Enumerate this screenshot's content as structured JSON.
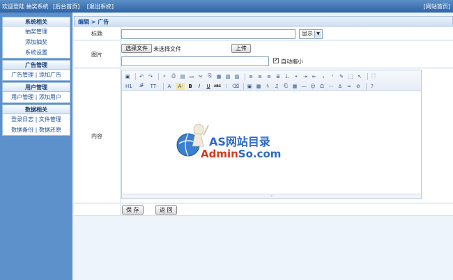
{
  "topbar": {
    "welcome": "欢迎登陆 抽奖系统",
    "nav": [
      "[后台首页]",
      "[退出系统]"
    ],
    "home": "[网站首页]"
  },
  "sidebar": {
    "groups": [
      {
        "title": "系统相关",
        "items": [
          "抽奖管理",
          "添加抽奖",
          "系统设置"
        ]
      },
      {
        "title": "广告管理",
        "items": [
          "广告管理 | 添加广告"
        ]
      },
      {
        "title": "用户管理",
        "items": [
          "用户管理 | 添加用户"
        ]
      },
      {
        "title": "数据相关",
        "items": [
          "登录日志 | 文件管理",
          "数据备份 | 数据还原"
        ]
      }
    ]
  },
  "breadcrumb": "编辑 > 广告",
  "form": {
    "title_label": "标题",
    "title_value": "",
    "display_select": "显示",
    "image_label": "图片",
    "choose_file": "选择文件",
    "no_file": "未选择文件",
    "upload": "上传",
    "image_path": "",
    "auto_shrink": "自动缩小",
    "content_label": "内容",
    "save": "保 存",
    "back": "返 回"
  },
  "toolbar": {
    "row2_labels": [
      "H1·",
      "𝓕·",
      "TT·",
      "A·",
      "A·",
      "B",
      "I",
      "U",
      "ABC"
    ]
  },
  "watermark": {
    "line1": "AS网站目录",
    "line2_a": "Admin",
    "line2_b": "So.com"
  },
  "colors": {
    "header": "#2e64a5",
    "sidebar": "#5d91cc",
    "link": "#1f4f9a"
  }
}
